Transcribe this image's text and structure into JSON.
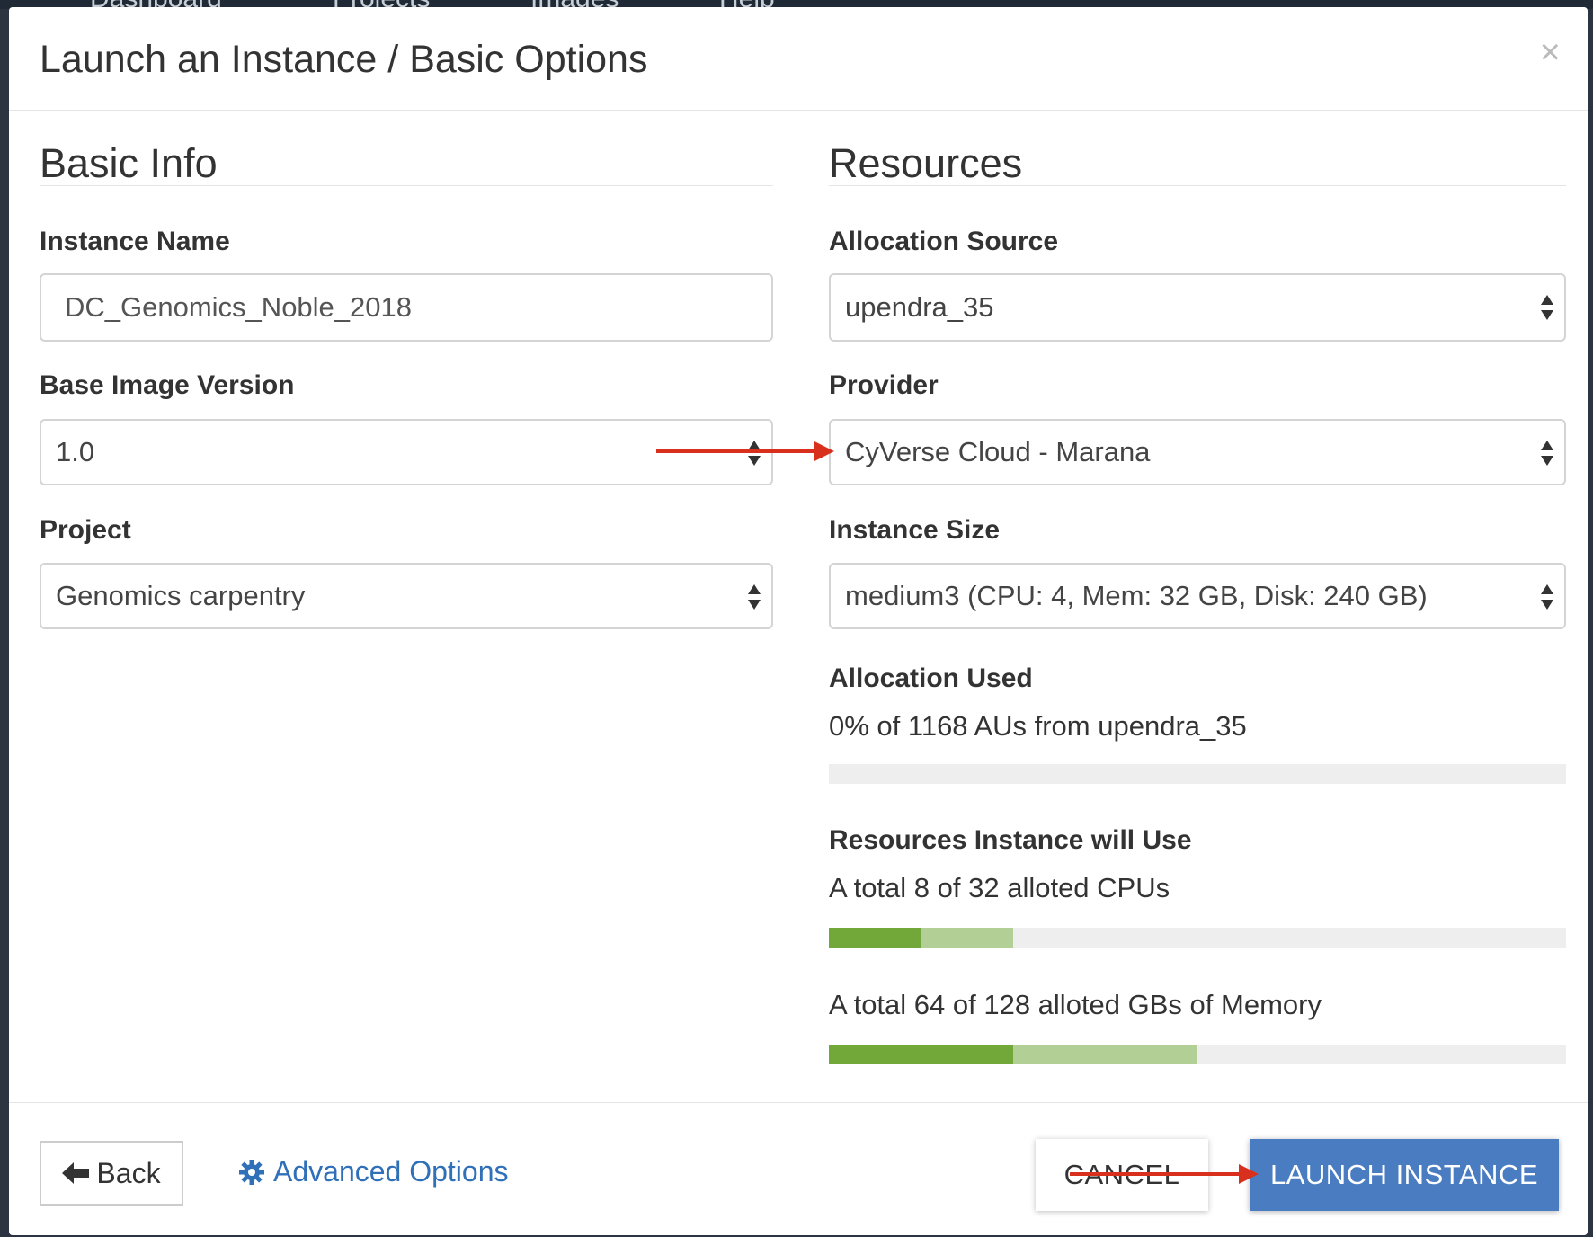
{
  "topnav": {
    "items": [
      "Dashboard",
      "Projects",
      "Images",
      "Help"
    ]
  },
  "modal": {
    "title": "Launch an Instance / Basic Options",
    "close_label": "×"
  },
  "basic_info": {
    "heading": "Basic Info",
    "instance_name": {
      "label": "Instance Name",
      "value": "DC_Genomics_Noble_2018"
    },
    "base_image_version": {
      "label": "Base Image Version",
      "value": "1.0"
    },
    "project": {
      "label": "Project",
      "value": "Genomics carpentry"
    }
  },
  "resources": {
    "heading": "Resources",
    "allocation_source": {
      "label": "Allocation Source",
      "value": "upendra_35"
    },
    "provider": {
      "label": "Provider",
      "value": "CyVerse Cloud - Marana"
    },
    "instance_size": {
      "label": "Instance Size",
      "value": "medium3 (CPU: 4, Mem: 32 GB, Disk: 240 GB)"
    },
    "allocation_used": {
      "label": "Allocation Used",
      "text": "0% of 1168 AUs from upendra_35",
      "percent": 0
    },
    "usage": {
      "label": "Resources Instance will Use",
      "cpu_text": "A total 8 of 32 alloted CPUs",
      "cpu_current_fraction": 0.125,
      "cpu_added_fraction": 0.125,
      "memory_text": "A total 64 of 128 alloted GBs of Memory",
      "memory_current_fraction": 0.25,
      "memory_added_fraction": 0.25
    }
  },
  "footer": {
    "back_label": "Back",
    "advanced_label": "Advanced Options",
    "cancel_label": "CANCEL",
    "launch_label": "LAUNCH INSTANCE"
  },
  "colors": {
    "primary": "#4a7cc1",
    "link": "#2f70b8",
    "bar_current": "#72a83a",
    "bar_added": "#b2cf95",
    "bar_track": "#eeeeee",
    "annotation_arrow": "#d9301e"
  }
}
